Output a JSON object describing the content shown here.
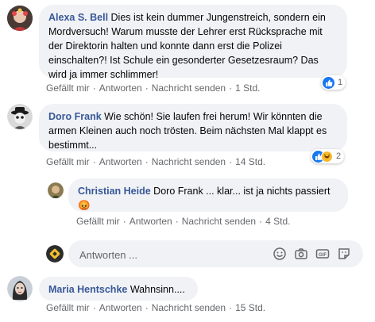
{
  "colors": {
    "link": "#385898",
    "meta": "#65676b",
    "bubble": "#f0f2f5",
    "like": "#1877f2",
    "haha": "#f7b928"
  },
  "comments": [
    {
      "author": "Alexa S. Bell",
      "text": "Dies ist kein dummer Jungenstreich, sondern ein Mordversuch! Warum musste der Lehrer erst Rücksprache mit der Direktorin halten und konnte dann erst die Polizei einschalten?! Ist Schule ein gesonderter Gesetzesraum? Das wird ja immer schlimmer!",
      "like_label": "Gefällt mir",
      "reply_label": "Antworten",
      "message_label": "Nachricht senden",
      "time": "1 Std.",
      "reaction_count": "1"
    },
    {
      "author": "Doro Frank",
      "text": "Wie schön! Sie laufen frei herum! Wir könnten die armen Kleinen auch noch trösten. Beim nächsten Mal klappt es bestimmt...",
      "like_label": "Gefällt mir",
      "reply_label": "Antworten",
      "message_label": "Nachricht senden",
      "time": "14 Std.",
      "reaction_count": "2"
    },
    {
      "author": "Christian Heide",
      "text": "Doro Frank ... klar... ist ja nichts passiert",
      "emoji": "😡",
      "like_label": "Gefällt mir",
      "reply_label": "Antworten",
      "message_label": "Nachricht senden",
      "time": "4 Std."
    },
    {
      "author": "Maria Hentschke",
      "text": "Wahnsinn....",
      "like_label": "Gefällt mir",
      "reply_label": "Antworten",
      "message_label": "Nachricht senden",
      "time": "15 Std."
    }
  ],
  "reply_box": {
    "placeholder": "Antworten ...",
    "icons": [
      "emoji-icon",
      "camera-icon",
      "gif-icon",
      "sticker-icon"
    ]
  }
}
